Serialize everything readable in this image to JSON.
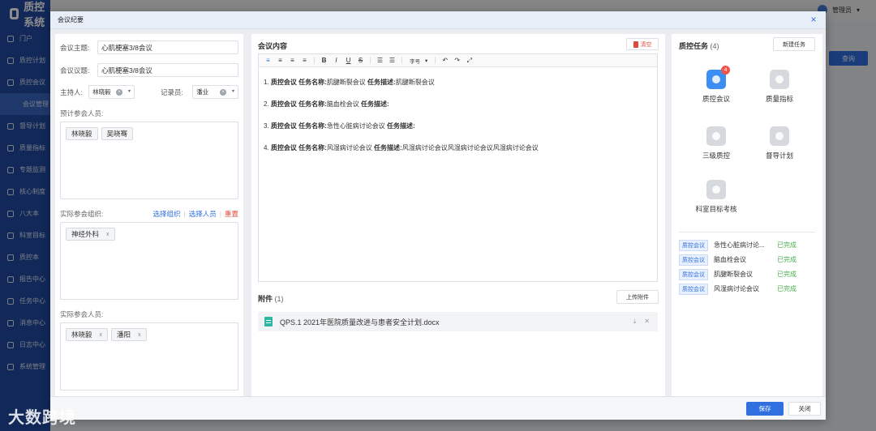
{
  "app": {
    "logo": "质控系统",
    "user": "管理员",
    "query_btn": "查询",
    "nav": [
      {
        "label": "门户"
      },
      {
        "label": "质控计划"
      },
      {
        "label": "质控会议"
      },
      {
        "label": "会议管理",
        "active": true
      },
      {
        "label": "督导计划"
      },
      {
        "label": "质量指标"
      },
      {
        "label": "专题监测"
      },
      {
        "label": "核心制度"
      },
      {
        "label": "八大本"
      },
      {
        "label": "科室目标"
      },
      {
        "label": "质控本"
      },
      {
        "label": "报告中心"
      },
      {
        "label": "任务中心"
      },
      {
        "label": "消息中心"
      },
      {
        "label": "日志中心"
      },
      {
        "label": "系统管理"
      }
    ]
  },
  "watermark": "大数跨境",
  "modal": {
    "title": "会议纪要",
    "close_icon": "×",
    "left": {
      "topic_label": "会议主题:",
      "topic_value": "心肌梗塞3/8会议",
      "issue_label": "会议议题:",
      "issue_value": "心肌梗塞3/8会议",
      "host_label": "主持人:",
      "host_value": "林晓毅",
      "recorder_label": "记录员:",
      "recorder_value": "潘业",
      "planned_label": "预计参会人员:",
      "planned": [
        "林晓毅",
        "吴晓骞"
      ],
      "org_label": "实际参会组织:",
      "org_links": {
        "select_org": "选择组织",
        "select_person": "选择人员",
        "reset": "重置"
      },
      "orgs": [
        "神经外科"
      ],
      "actual_label": "实际参会人员:",
      "actual": [
        "林晓毅",
        "潘阳"
      ],
      "tag_remove": "x"
    },
    "middle": {
      "title": "会议内容",
      "clear_btn": "清空",
      "font_size_label": "字号",
      "items": [
        {
          "num": "1.",
          "meeting": "质控会议",
          "name_label": "任务名称:",
          "name": "肌腱断裂会议",
          "desc_label": "任务描述:",
          "desc": "肌腱断裂会议"
        },
        {
          "num": "2.",
          "meeting": "质控会议",
          "name_label": "任务名称:",
          "name": "脑血栓会议",
          "desc_label": "任务描述:",
          "desc": ""
        },
        {
          "num": "3.",
          "meeting": "质控会议",
          "name_label": "任务名称:",
          "name": "急性心脏病讨论会议",
          "desc_label": "任务描述:",
          "desc": ""
        },
        {
          "num": "4.",
          "meeting": "质控会议",
          "name_label": "任务名称:",
          "name": "风湿病讨论会议",
          "desc_label": "任务描述:",
          "desc": "风湿病讨论会议风湿病讨论会议风湿病讨论会议"
        }
      ],
      "attachment_title": "附件",
      "attachment_count": "(1)",
      "upload_btn": "上传附件",
      "file_name": "QPS.1 2021年医院质量改进与患者安全计划.docx"
    },
    "right": {
      "title": "质控任务",
      "count": "(4)",
      "new_task_btn": "新建任务",
      "tiles": [
        {
          "label": "质控会议",
          "badge": "4"
        },
        {
          "label": "质量指标"
        },
        {
          "label": "三级质控"
        },
        {
          "label": "督导计划"
        },
        {
          "label": "科室目标考核"
        }
      ],
      "tasks": [
        {
          "tag": "质控会议",
          "name": "急性心脏病讨论...",
          "status": "已完成"
        },
        {
          "tag": "质控会议",
          "name": "脑血栓会议",
          "status": "已完成"
        },
        {
          "tag": "质控会议",
          "name": "肌腱断裂会议",
          "status": "已完成"
        },
        {
          "tag": "质控会议",
          "name": "风湿病讨论会议",
          "status": "已完成"
        }
      ]
    },
    "footer": {
      "save": "保存",
      "close": "关闭"
    }
  }
}
